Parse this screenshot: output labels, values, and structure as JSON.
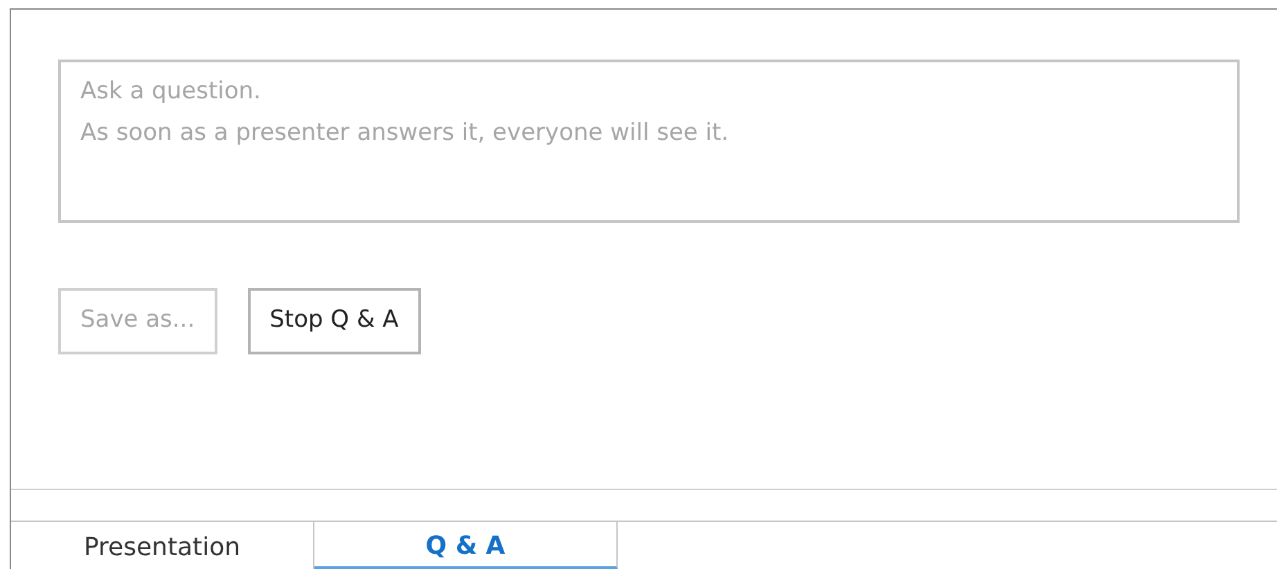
{
  "question_field": {
    "placeholder": "Ask a question.\nAs soon as a presenter answers it, everyone will see it."
  },
  "buttons": [
    {
      "label": "Save as...",
      "disabled": true
    },
    {
      "label": "Stop Q & A",
      "disabled": false
    }
  ],
  "tabs": [
    {
      "label": "Presentation",
      "selected": false
    },
    {
      "label": "Q & A",
      "selected": true
    }
  ]
}
